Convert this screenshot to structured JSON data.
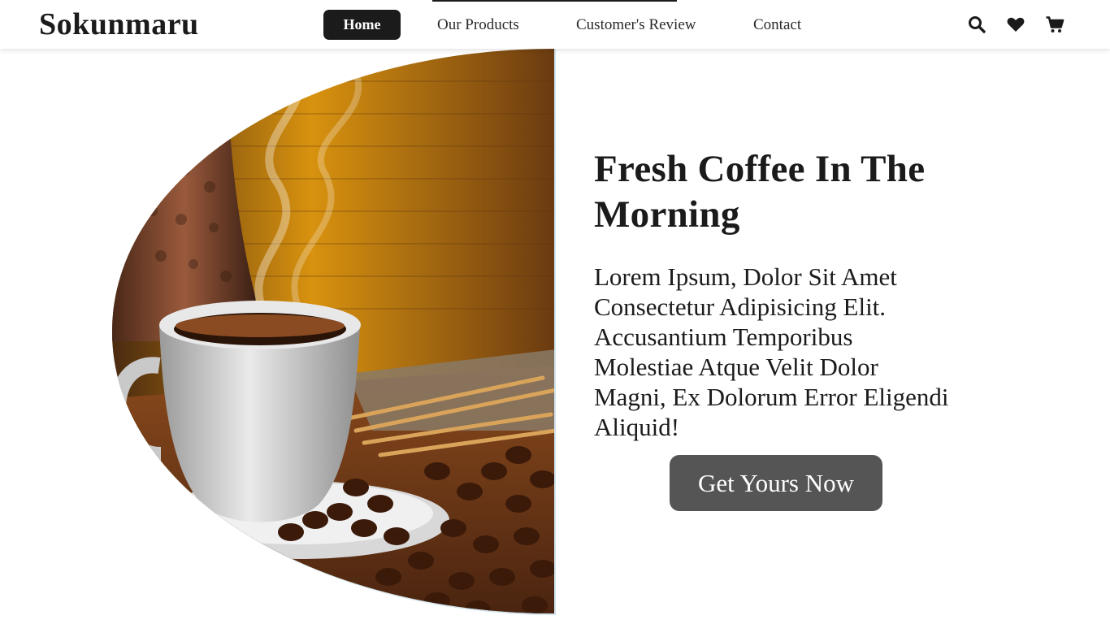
{
  "brand": {
    "name": "Sokunmaru"
  },
  "nav": {
    "items": [
      {
        "label": "Home",
        "active": true
      },
      {
        "label": "Our Products",
        "active": false
      },
      {
        "label": "Customer's Review",
        "active": false
      },
      {
        "label": "Contact",
        "active": false
      }
    ]
  },
  "header_icons": [
    "search-icon",
    "heart-icon",
    "cart-icon"
  ],
  "hero": {
    "title": "Fresh Coffee In The Morning",
    "text": "Lorem Ipsum, Dolor Sit Amet Consectetur Adipisicing Elit. Accusantium Temporibus Molestiae Atque Velit Dolor Magni, Ex Dolorum Error Eligendi Aliquid!",
    "cta_label": "Get Yours Now"
  },
  "colors": {
    "primary": "#1b1b1b",
    "button": "#555555",
    "background": "#ffffff"
  }
}
